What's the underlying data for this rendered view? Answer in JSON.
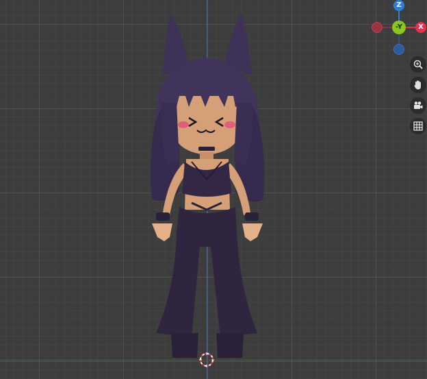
{
  "viewport": {
    "grid": true
  },
  "gizmo": {
    "z_label": "Z",
    "y_label": "-Y",
    "x_label": "X",
    "colors": {
      "z": "#2f7ed8",
      "y": "#8bc61f",
      "x": "#e2334a",
      "neg_x": "#9b3340",
      "neg_z": "#2d5c9a"
    }
  },
  "toolbar": {
    "items": [
      {
        "name": "zoom",
        "icon": "magnifier-plus-icon"
      },
      {
        "name": "pan",
        "icon": "hand-icon"
      },
      {
        "name": "camera",
        "icon": "camera-icon"
      },
      {
        "name": "perspective",
        "icon": "grid-icon"
      }
    ]
  },
  "model": {
    "hair_color": "#3b2f55",
    "skin_color": "#d9a27a",
    "outfit_color": "#2f2540"
  }
}
